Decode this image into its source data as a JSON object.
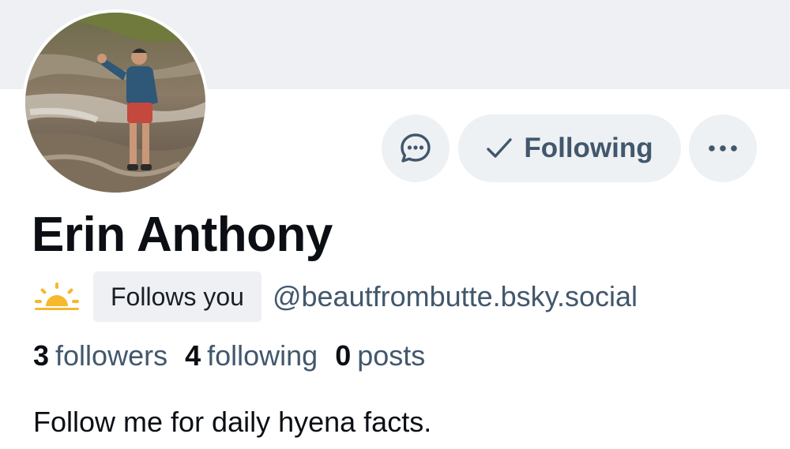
{
  "profile": {
    "display_name": "Erin Anthony",
    "handle": "@beautfrombutte.bsky.social",
    "follows_you_badge": "Follows you",
    "status_icon": "sun-icon",
    "bio": "Follow me for daily hyena facts."
  },
  "actions": {
    "message_icon": "chat-bubble-icon",
    "following_label": "Following",
    "following_icon": "checkmark-icon",
    "more_icon": "ellipsis-icon"
  },
  "stats": {
    "followers_count": "3",
    "followers_label": "followers",
    "following_count": "4",
    "following_label": "following",
    "posts_count": "0",
    "posts_label": "posts"
  },
  "colors": {
    "banner": "#eef0f3",
    "button_bg": "#eef1f4",
    "muted_text": "#42576c",
    "primary_text": "#0b0f14",
    "sun": "#f5b82e"
  }
}
